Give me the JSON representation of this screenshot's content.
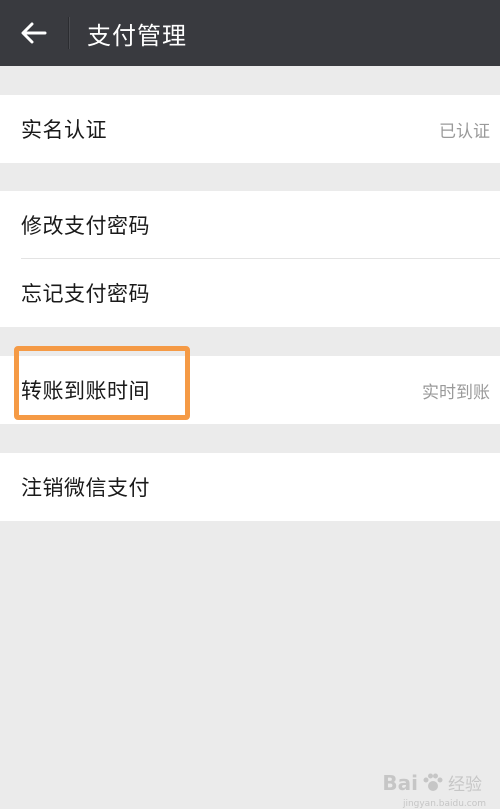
{
  "header": {
    "title": "支付管理",
    "back_icon": "arrow-left-icon"
  },
  "groups": [
    {
      "rows": [
        {
          "label": "实名认证",
          "value": "已认证"
        }
      ]
    },
    {
      "rows": [
        {
          "label": "修改支付密码",
          "value": ""
        },
        {
          "label": "忘记支付密码",
          "value": ""
        }
      ]
    },
    {
      "rows": [
        {
          "label": "转账到账时间",
          "value": "实时到账"
        }
      ]
    },
    {
      "rows": [
        {
          "label": "注销微信支付",
          "value": ""
        }
      ]
    }
  ],
  "highlight_color": "#f59a45",
  "watermark": {
    "brand": "Bai",
    "suffix": "经验",
    "url": "jingyan.baidu.com"
  }
}
